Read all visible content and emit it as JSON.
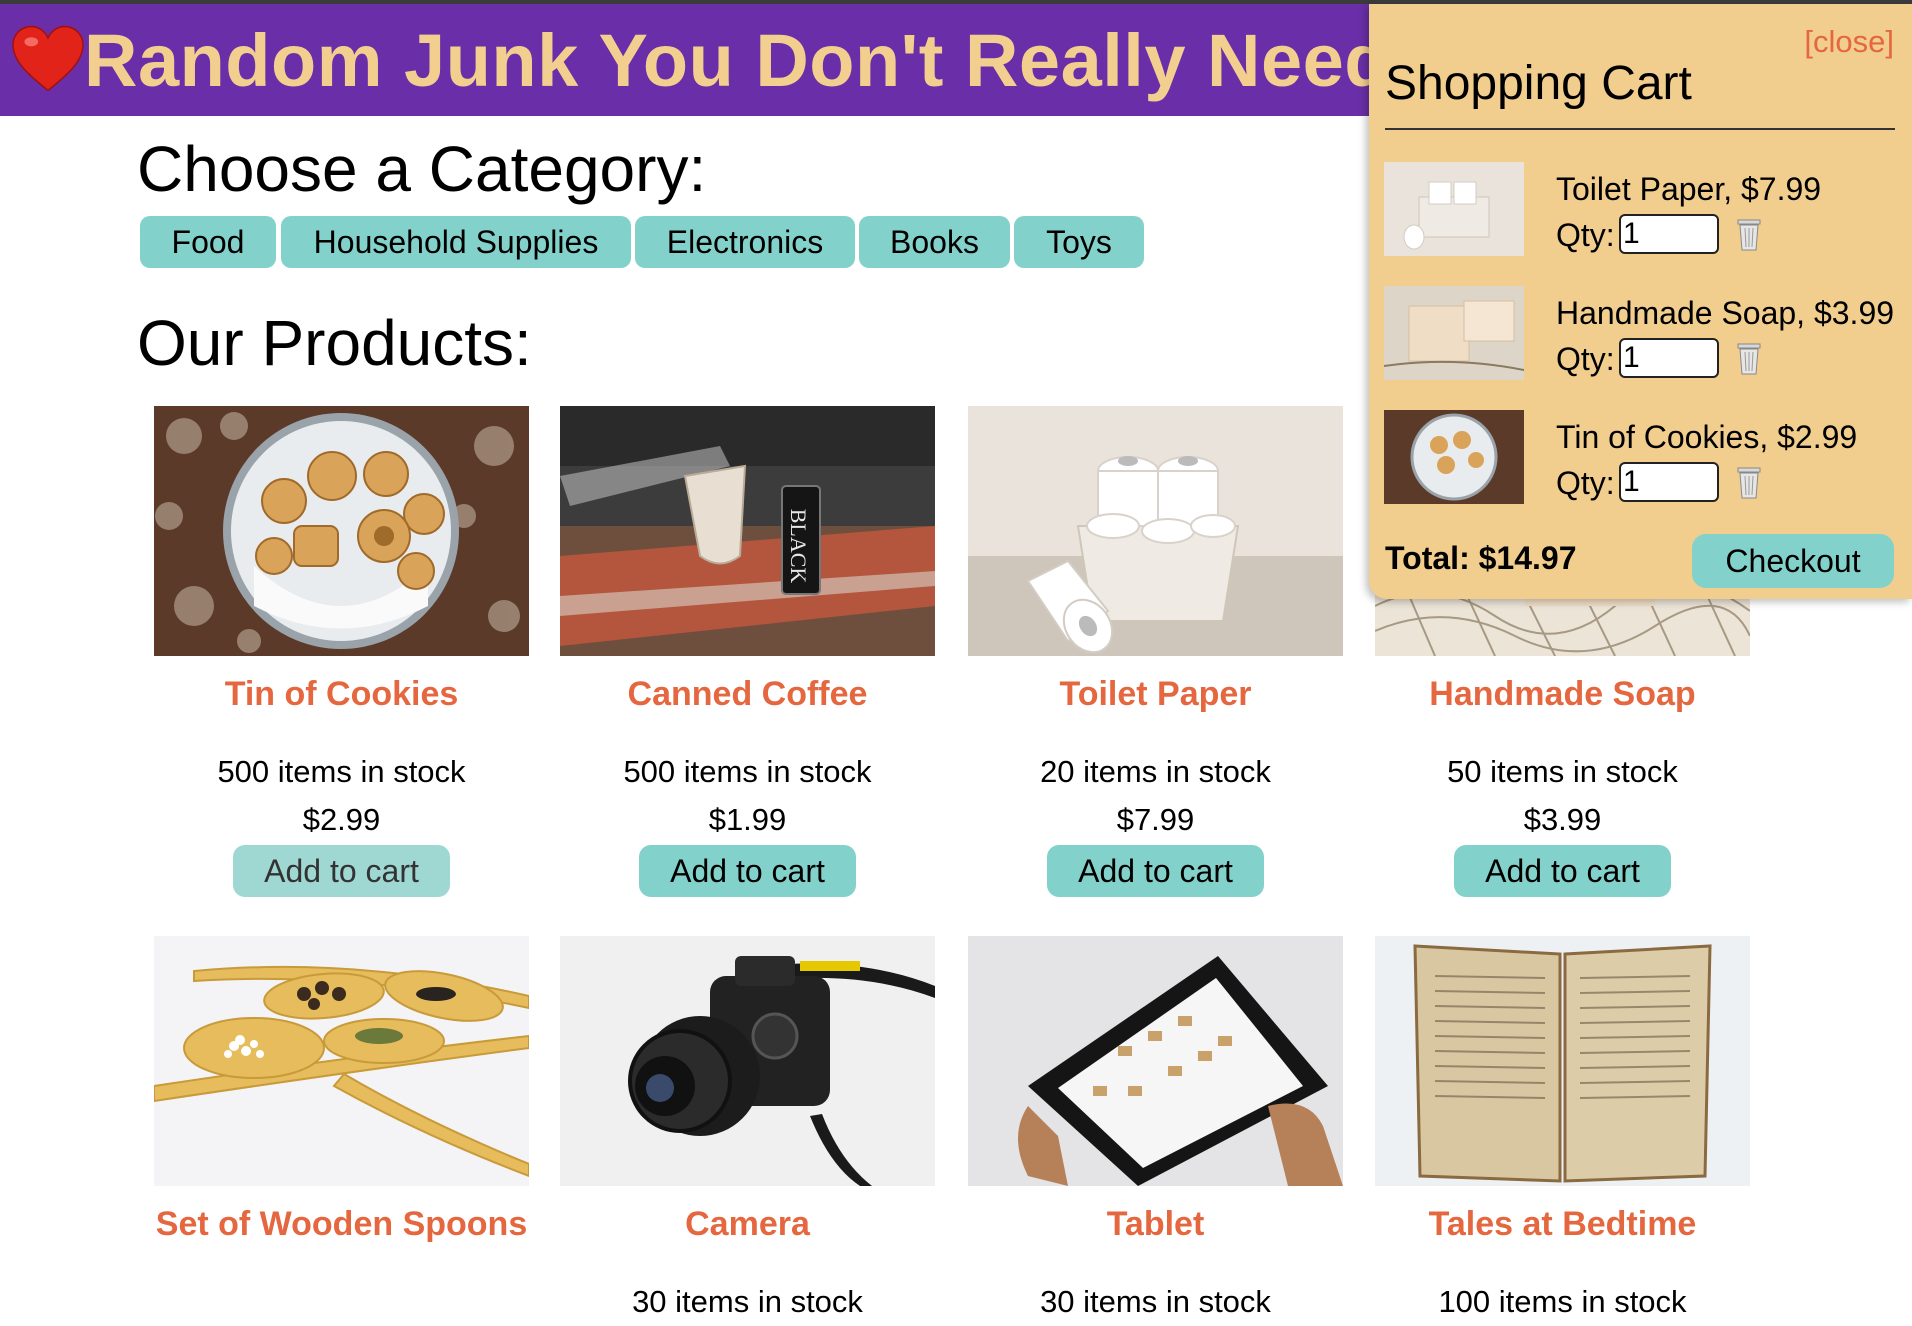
{
  "header": {
    "title": "Random Junk You Don't Really Need",
    "logo_icon": "heart-icon"
  },
  "categories": {
    "heading": "Choose a Category:",
    "items": [
      {
        "label": "Food"
      },
      {
        "label": "Household Supplies"
      },
      {
        "label": "Electronics"
      },
      {
        "label": "Books"
      },
      {
        "label": "Toys"
      }
    ]
  },
  "products": {
    "heading": "Our Products:",
    "items": [
      {
        "name": "Tin of Cookies",
        "stock": "500 items in stock",
        "price": "$2.99",
        "button": "Add to cart"
      },
      {
        "name": "Canned Coffee",
        "stock": "500 items in stock",
        "price": "$1.99",
        "button": "Add to cart"
      },
      {
        "name": "Toilet Paper",
        "stock": "20 items in stock",
        "price": "$7.99",
        "button": "Add to cart"
      },
      {
        "name": "Handmade Soap",
        "stock": "50 items in stock",
        "price": "$3.99",
        "button": "Add to cart"
      },
      {
        "name": "Set of Wooden Spoons",
        "stock": "",
        "price": "",
        "button": ""
      },
      {
        "name": "Camera",
        "stock": "30 items in stock",
        "price": "",
        "button": ""
      },
      {
        "name": "Tablet",
        "stock": "30 items in stock",
        "price": "",
        "button": ""
      },
      {
        "name": "Tales at Bedtime",
        "stock": "100 items in stock",
        "price": "",
        "button": ""
      }
    ]
  },
  "cart": {
    "close_label": "[close]",
    "title": "Shopping Cart",
    "qty_label": "Qty:",
    "items": [
      {
        "label": "Toilet Paper, $7.99",
        "qty": "1"
      },
      {
        "label": "Handmade Soap, $3.99",
        "qty": "1"
      },
      {
        "label": "Tin of Cookies, $2.99",
        "qty": "1"
      }
    ],
    "total": "Total: $14.97",
    "checkout_label": "Checkout"
  },
  "colors": {
    "header_bg": "#6a2fa8",
    "title_text": "#f3cf8f",
    "accent_button": "#83d1cb",
    "product_name": "#e5673f",
    "cart_bg": "#f1cd8e"
  }
}
